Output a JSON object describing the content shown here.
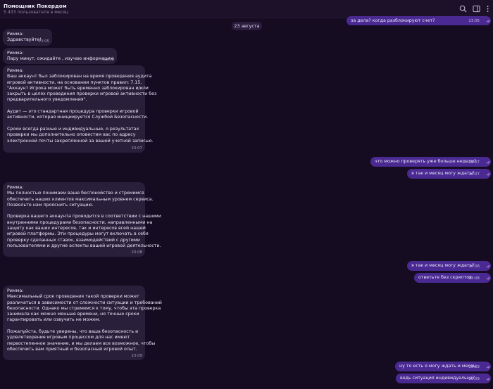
{
  "header": {
    "title": "Помощник Покердом",
    "subtitle": "5 433 пользователя в месяц",
    "icons": [
      "search-icon",
      "sidebar-icon",
      "more-icon"
    ]
  },
  "date_separator": "23 августа",
  "messages": [
    {
      "dir": "out",
      "lines": [
        "за дела? когда разблокируют счет?"
      ],
      "time": "23:05",
      "read": true
    },
    {
      "dir": "in",
      "lines": [
        "Римма:",
        "Здравствуйте!"
      ],
      "time": "23:05"
    },
    {
      "dir": "in",
      "lines": [
        "Римма:",
        "Пару минут, ожидайте , изучаю информацию"
      ],
      "time": "23:05"
    },
    {
      "dir": "in",
      "lines": [
        "Римма:",
        "Ваш аккаунт был заблокирован на время проведения аудита",
        "игровой активности, на основании пунктов правил: 7.15.",
        "\"Аккаунт Игрока может быть временно заблокирован и/или",
        "закрыть в целях проведения проверки игровой активности без",
        "предварительного уведомления\".",
        "",
        "Аудит — это стандартная процедура проверки игровой",
        "активности, которая инициируется Службой Безопасности.",
        "",
        "Сроки всегда разные и индивидуальные, о результатах",
        "проверки мы дополнительно оповестим вас по адресу",
        "электронной почты закрепленной за вашей учетной записью."
      ],
      "time": "23:07"
    },
    {
      "dir": "out",
      "lines": [
        "что можно проверять уже больше недели?"
      ],
      "time": "23:07",
      "read": true
    },
    {
      "dir": "out",
      "lines": [
        "я так и месяц могу ждать?"
      ],
      "time": "23:07",
      "read": true
    },
    {
      "dir": "in",
      "lines": [
        "Римма:",
        "Мы полностью понимаем ваше беспокойство и стремимся",
        "обеспечить наших клиентов максимальным уровнем сервиса.",
        "Позвольте нам прояснить ситуацию.",
        "",
        "Проверка вашего аккаунта проводится в соответствии с нашими",
        "внутренними процедурами безопасности, направленными на",
        "защиту как ваших интересов, так и интересов всей нашей",
        "игровой платформы. Эти процедуры могут включать в себя",
        "проверку сделанных ставок, взаимодействий с другими",
        "пользователями и другие аспекты вашей игровой деятельности."
      ],
      "time": "23:08"
    },
    {
      "dir": "out",
      "lines": [
        "я так и месяц могу ждать?"
      ],
      "time": "23:08",
      "read": true
    },
    {
      "dir": "out",
      "lines": [
        "ответьте без скриптов"
      ],
      "time": "23:08",
      "read": true
    },
    {
      "dir": "in",
      "lines": [
        "Римма:",
        "Максимальный срок проведения такой проверки может",
        "различаться в зависимости от сложности ситуации и требований",
        "безопасности. Однако мы стремимся к тому, чтобы эта проверка",
        "занимала как можно меньше времени, но точные сроки",
        "гарантировать или озвучить не можем.",
        "",
        "Пожалуйста, будьте уверены, что ваша безопасность и",
        "удовлетворение игровым процессом для нас имеют",
        "первостепенное значение, и мы делаем все возможное, чтобы",
        "обеспечить вам приятный и безопасный игровой опыт."
      ],
      "time": "23:09"
    },
    {
      "dir": "out",
      "lines": [
        "ну то есть я могу ждать и месяц"
      ],
      "time": "23:09",
      "read": true
    },
    {
      "dir": "out",
      "lines": [
        "ведь ситуация индивидуальна?"
      ],
      "time": "23:09",
      "read": true
    }
  ]
}
